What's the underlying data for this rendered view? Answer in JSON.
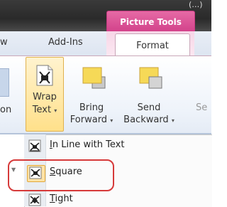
{
  "picture_tools": {
    "title": "Picture Tools"
  },
  "tabs": {
    "left_cut": "w",
    "addins": "Add-Ins",
    "format": "Format"
  },
  "ribbon": {
    "left_cut_label": "on",
    "right_cut_label": "Se",
    "wrap_text": {
      "line1": "Wrap",
      "line2": "Text",
      "dropdown": "▾"
    },
    "bring_forward": {
      "line1": "Bring",
      "line2": "Forward",
      "dropdown": "▾"
    },
    "send_backward": {
      "line1": "Send",
      "line2": "Backward",
      "dropdown": "▾"
    }
  },
  "menu": {
    "items": [
      {
        "accel": "I",
        "rest": "n Line with Text"
      },
      {
        "accel": "S",
        "rest": "quare"
      },
      {
        "accel": "T",
        "rest": "ight"
      }
    ]
  },
  "colors": {
    "accent_pink": "#d2418a",
    "highlight_red": "#d63a3a",
    "button_hover_gold": "#ffe08a"
  }
}
